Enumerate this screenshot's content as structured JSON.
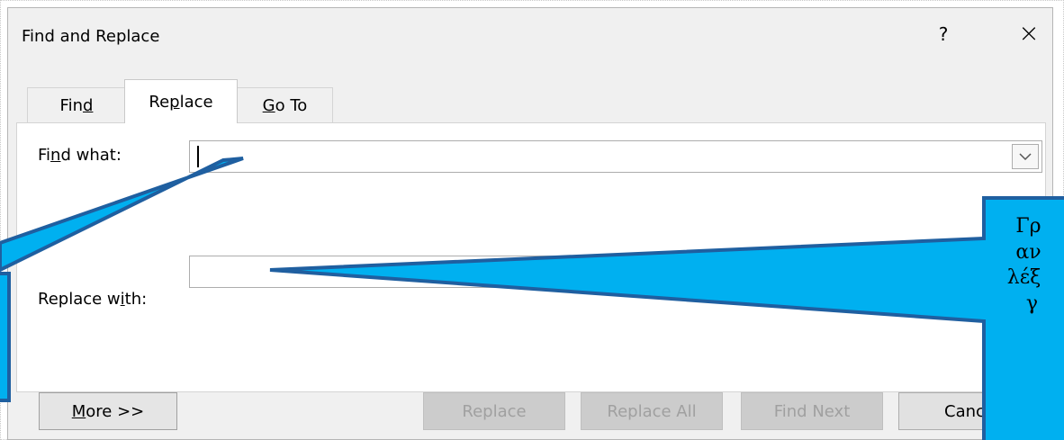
{
  "dialog": {
    "title": "Find and Replace",
    "help_label": "?",
    "close_label": "×"
  },
  "tabs": [
    {
      "label": "Find"
    },
    {
      "label": "Replace",
      "selected": true
    },
    {
      "label": "Go To"
    }
  ],
  "find": {
    "label": "Find what:",
    "value": "",
    "dropdown_icon": "chevron-down-icon"
  },
  "replace": {
    "label": "Replace with:",
    "value": ""
  },
  "buttons": {
    "more": "More >>",
    "replace": "Replace",
    "replace_all": "Replace All",
    "find_next": "Find Next",
    "cancel": "Cance"
  },
  "callout": {
    "lines": [
      "Γρ",
      "",
      "αν",
      "λέξ",
      "γ"
    ],
    "fill": "#00b0f0",
    "border": "#1f5fa0"
  }
}
